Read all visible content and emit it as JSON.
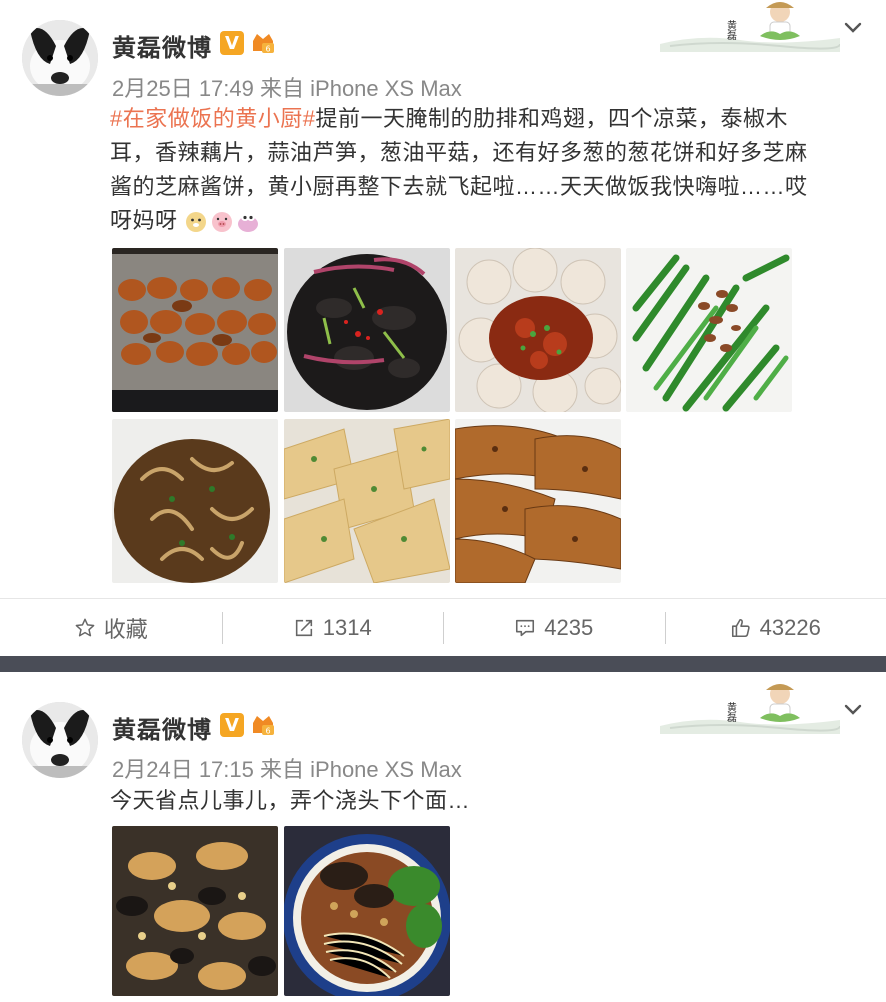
{
  "posts": [
    {
      "author": "黄磊微博",
      "v_badge": "V",
      "time": "2月25日 17:49",
      "source_prefix": "来自",
      "source": "iPhone XS Max",
      "hashtag": "#在家做饭的黄小厨#",
      "text_line1": "提前一天腌制的肋排和鸡翅，四个凉菜，泰椒木",
      "text_line2": "耳，香辣藕片，蒜油芦笋，葱油平菇，还有好多葱的葱花饼和好多芝麻",
      "text_line3": "酱的芝麻酱饼，黄小厨再整下去就飞起啦……天天做饭我快嗨啦……哎",
      "text_line4": "呀妈呀",
      "banner_name": "黄磊",
      "actions": {
        "favorite": "收藏",
        "repost": "1314",
        "comment": "4235",
        "like": "43226"
      }
    },
    {
      "author": "黄磊微博",
      "v_badge": "V",
      "time": "2月24日 17:15",
      "source_prefix": "来自",
      "source": "iPhone XS Max",
      "text": "今天省点儿事儿，弄个浇头下个面…",
      "banner_name": "黄磊"
    }
  ],
  "colors": {
    "hashtag": "#eb7350",
    "divider": "#4a4d57",
    "v_badge": "#f5a623"
  }
}
